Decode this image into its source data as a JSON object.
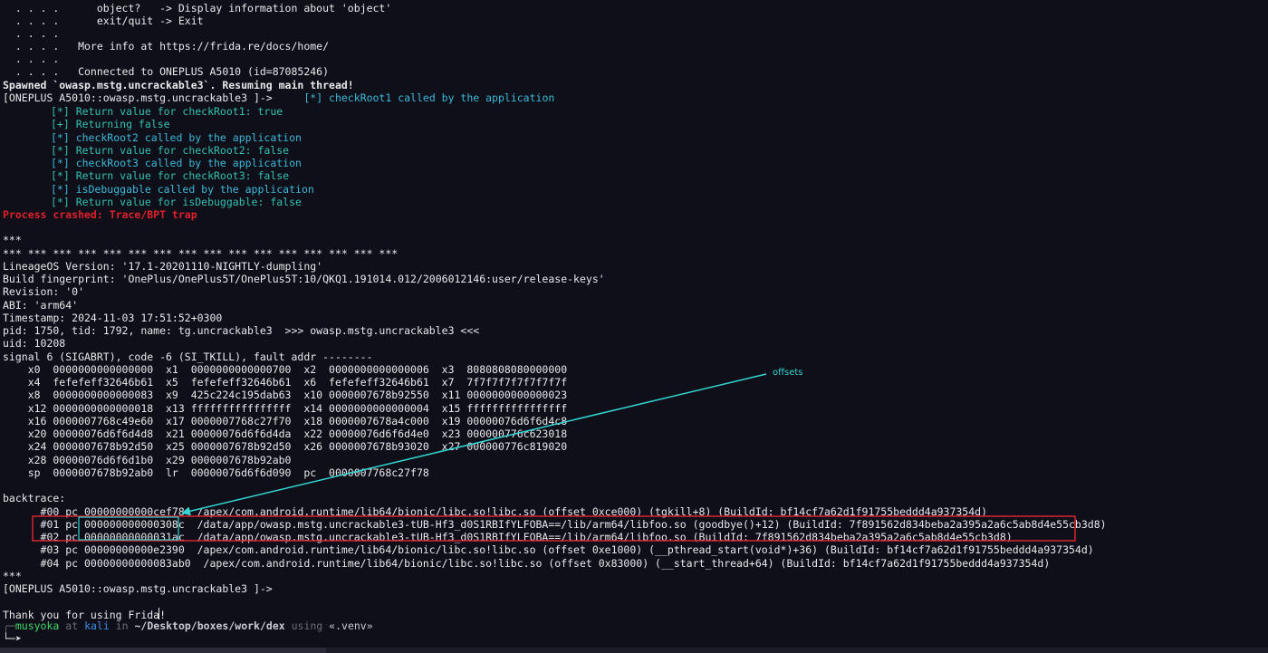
{
  "terminal": {
    "banner": [
      "  . . . .      object?   -> Display information about 'object'",
      "  . . . .      exit/quit -> Exit",
      "  . . . .",
      "  . . . .   More info at https://frida.re/docs/home/",
      "  . . . .",
      "  . . . .   Connected to ONEPLUS A5010 (id=87085246)"
    ],
    "spawned": "Spawned `owasp.mstg.uncrackable3`. Resuming main thread!",
    "prompt_first": "[ONEPLUS A5010::owasp.mstg.uncrackable3 ]->",
    "first_hook": "[*] checkRoot1 called by the application",
    "hooks": [
      {
        "text": "[*] Return value for checkRoot1: true",
        "color": "teal"
      },
      {
        "text": "[+] Returning false",
        "color": "teal"
      },
      {
        "text": "[*] checkRoot2 called by the application",
        "color": "cyan"
      },
      {
        "text": "[*] Return value for checkRoot2: false",
        "color": "teal"
      },
      {
        "text": "[*] checkRoot3 called by the application",
        "color": "cyan"
      },
      {
        "text": "[*] Return value for checkRoot3: false",
        "color": "teal"
      },
      {
        "text": "[*] isDebuggable called by the application",
        "color": "cyan"
      },
      {
        "text": "[*] Return value for isDebuggable: false",
        "color": "teal"
      }
    ],
    "crash": "Process crashed: Trace/BPT trap",
    "tombstone": [
      "",
      "***",
      "*** *** *** *** *** *** *** *** *** *** *** *** *** *** *** ***",
      "LineageOS Version: '17.1-20201110-NIGHTLY-dumpling'",
      "Build fingerprint: 'OnePlus/OnePlus5T/OnePlus5T:10/QKQ1.191014.012/2006012146:user/release-keys'",
      "Revision: '0'",
      "ABI: 'arm64'",
      "Timestamp: 2024-11-03 17:51:52+0300",
      "pid: 1750, tid: 1792, name: tg.uncrackable3  >>> owasp.mstg.uncrackable3 <<<",
      "uid: 10208",
      "signal 6 (SIGABRT), code -6 (SI_TKILL), fault addr --------",
      "    x0  0000000000000000  x1  0000000000000700  x2  0000000000000006  x3  8080808080000000",
      "    x4  fefefeff32646b61  x5  fefefeff32646b61  x6  fefefeff32646b61  x7  7f7f7f7f7f7f7f7f",
      "    x8  0000000000000083  x9  425c224c195dab63  x10 0000007678b92550  x11 0000000000000023",
      "    x12 0000000000000018  x13 ffffffffffffffff  x14 0000000000000004  x15 ffffffffffffffff",
      "    x16 0000007768c49e60  x17 0000007768c27f70  x18 0000007678a4c000  x19 00000076d6f6d4c8",
      "    x20 00000076d6f6d4d8  x21 00000076d6f6d4da  x22 00000076d6f6d4e0  x23 000000776c623018",
      "    x24 0000007678b92d50  x25 0000007678b92d50  x26 0000007678b93020  x27 000000776c819020",
      "    x28 00000076d6f6d1b0  x29 0000007678b92ab0",
      "    sp  0000007678b92ab0  lr  00000076d6f6d090  pc  0000007768c27f78",
      "",
      "backtrace:",
      "      #00 pc 00000000000cef78  /apex/com.android.runtime/lib64/bionic/libc.so!libc.so (offset 0xce000) (tgkill+8) (BuildId: bf14cf7a62d1f91755beddd4a937354d)",
      "      #01 pc 000000000000308c  /data/app/owasp.mstg.uncrackable3-tUB-Hf3_d0S1RBIfYLFOBA==/lib/arm64/libfoo.so (goodbye()+12) (BuildId: 7f891562d834beba2a395a2a6c5ab8d4e55cb3d8)",
      "      #02 pc 00000000000031ac  /data/app/owasp.mstg.uncrackable3-tUB-Hf3_d0S1RBIfYLFOBA==/lib/arm64/libfoo.so (BuildId: 7f891562d834beba2a395a2a6c5ab8d4e55cb3d8)",
      "      #03 pc 00000000000e2390  /apex/com.android.runtime/lib64/bionic/libc.so!libc.so (offset 0xe1000) (__pthread_start(void*)+36) (BuildId: bf14cf7a62d1f91755beddd4a937354d)",
      "      #04 pc 00000000000083ab0  /apex/com.android.runtime/lib64/bionic/libc.so!libc.so (offset 0x83000) (__start_thread+64) (BuildId: bf14cf7a62d1f91755beddd4a937354d)",
      "***",
      "[ONEPLUS A5010::owasp.mstg.uncrackable3 ]->",
      "",
      "Thank you for using Frida!"
    ],
    "shell_prompt": {
      "user": "musyoka",
      "at": "at",
      "host": "kali",
      "in": "in",
      "path": "~/Desktop/boxes/work/dex",
      "using": "using",
      "venv": "«.venv»",
      "arrow": "└─➤"
    },
    "annotation": {
      "label": "offsets",
      "arrow_color": "#33d6d2",
      "box_color": "#d8232f"
    }
  }
}
